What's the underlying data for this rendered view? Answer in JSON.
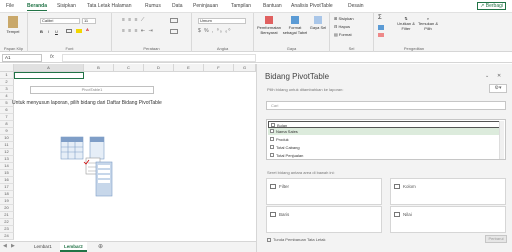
{
  "ribbon_tabs": [
    "File",
    "Beranda",
    "Sisipkan",
    "Tata Letak Halaman",
    "Rumus",
    "Data",
    "Peninjauan",
    "Tampilan",
    "Bantuan",
    "Analisis PivotTable",
    "Desain"
  ],
  "share_label": "Berbagi",
  "ribbon": {
    "paste_label": "Tempel",
    "font_name": "Calibri",
    "font_size": "11",
    "number_format": "Umum",
    "group_clipboard": "Papan Klip",
    "group_font": "Font",
    "group_alignment": "Perataan",
    "group_number": "Angka",
    "group_styles": "Gaya",
    "group_cells": "Sel",
    "group_editing": "Pengeditan",
    "conditional_label": "Pemformatan Bersyarat",
    "format_table_label": "Format sebagai Tabel",
    "cell_styles_label": "Gaya Sel",
    "insert_label": "Sisipkan",
    "delete_label": "Hapus",
    "format_label": "Format",
    "sort_label": "Urutkan & Filter",
    "find_label": "Temukan & Pilih"
  },
  "formula_bar": {
    "name_box": "A1",
    "fx": "fx",
    "value": ""
  },
  "grid": {
    "columns": [
      "A",
      "B",
      "C",
      "D",
      "E",
      "F",
      "G"
    ],
    "rows": [
      "1",
      "2",
      "3",
      "4",
      "5",
      "6",
      "7",
      "8",
      "9",
      "10",
      "11",
      "12",
      "13",
      "14",
      "15",
      "16",
      "17",
      "18",
      "19",
      "20",
      "21",
      "22",
      "23",
      "24",
      "25"
    ],
    "pivot_placeholder_title": "PivotTable1",
    "pivot_placeholder_text": "Untuk menyusun laporan, pilih bidang dari Daftar Bidang PivotTable"
  },
  "sheets": [
    "Lembar1",
    "Lembar2"
  ],
  "active_sheet": "Lembar2",
  "pane": {
    "title": "Bidang PivotTable",
    "subtitle": "Pilih bidang untuk ditambahkan ke laporan:",
    "search_placeholder": "Cari",
    "fields": [
      "Bulan",
      "Nama Sales",
      "Produk",
      "Total Cabang",
      "Total Penjualan"
    ],
    "drag_hint": "Seret bidang antara area di bawah ini:",
    "area_filters": "Filter",
    "area_columns": "Kolom",
    "area_rows": "Baris",
    "area_values": "Nilai",
    "defer_label": "Tunda Pembaruan Tata Letak",
    "update_label": "Perbarui"
  },
  "colors": {
    "accent": "#217346",
    "ribbon_bg": "#f3f3f3"
  }
}
